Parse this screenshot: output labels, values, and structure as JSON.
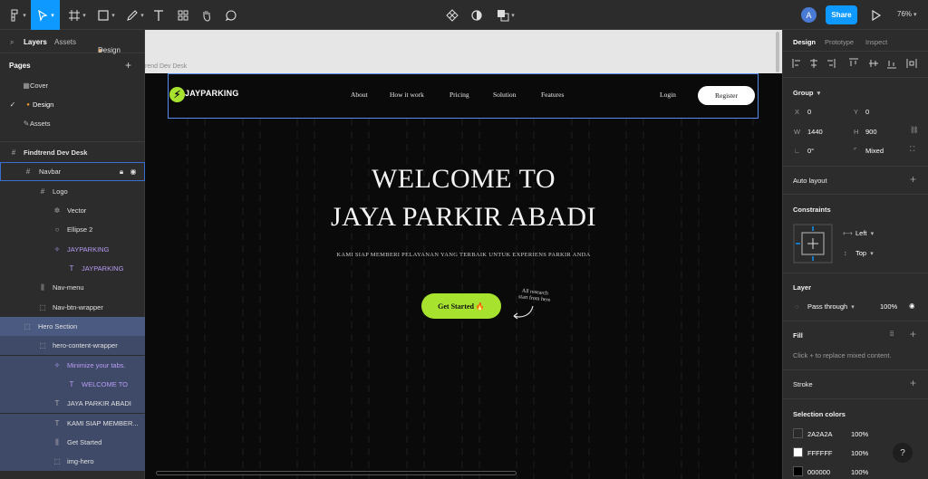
{
  "toolbar": {
    "avatar_initial": "A",
    "share_label": "Share",
    "zoom": "76%"
  },
  "left_panel": {
    "tab_layers": "Layers",
    "tab_assets": "Assets",
    "tab_design": "Design",
    "pages_title": "Pages",
    "pages": [
      "Cover",
      "Design",
      "Assets"
    ],
    "layers": [
      {
        "label": "Findtrend Dev Desk"
      },
      {
        "label": "Navbar"
      },
      {
        "label": "Logo"
      },
      {
        "label": "Vector"
      },
      {
        "label": "Ellipse 2"
      },
      {
        "label": "JAYPARKING"
      },
      {
        "label": "JAYPARKING"
      },
      {
        "label": "Nav-menu"
      },
      {
        "label": "Nav-btn-wrapper"
      },
      {
        "label": "Hero Section"
      },
      {
        "label": "hero-content-wrapper"
      },
      {
        "label": "Minimize your tabs."
      },
      {
        "label": "WELCOME TO"
      },
      {
        "label": "JAYA PARKIR ABADI"
      },
      {
        "label": "KAMI SIAP MEMBER..."
      },
      {
        "label": "Get Started"
      },
      {
        "label": "img-hero"
      }
    ]
  },
  "canvas": {
    "frame_label": "rend Dev Desk",
    "logo_text": "JAYPARKING",
    "nav": [
      "About",
      "How it work",
      "Pricing",
      "Solution",
      "Features"
    ],
    "login": "Login",
    "register": "Register",
    "hero_line1": "WELCOME TO",
    "hero_line2": "JAYA PARKIR ABADI",
    "hero_sub": "KAMI SIAP MEMBERI PELAYANAN YANG TERBAIK UNTUK EXPERIENS PARKIR ANDA",
    "cta": "Get Started",
    "cta_emoji": "🔥",
    "note_line1": "All research",
    "note_line2": "start from here"
  },
  "right_panel": {
    "tabs": [
      "Design",
      "Prototype",
      "Inspect"
    ],
    "group_title": "Group",
    "x_label": "X",
    "x_value": "0",
    "y_label": "Y",
    "y_value": "0",
    "w_label": "W",
    "w_value": "1440",
    "h_label": "H",
    "h_value": "900",
    "rotation": "0°",
    "radius": "Mixed",
    "auto_layout": "Auto layout",
    "constraints_title": "Constraints",
    "constraint_h": "Left",
    "constraint_v": "Top",
    "layer_title": "Layer",
    "blend": "Pass through",
    "opacity": "100%",
    "fill_title": "Fill",
    "fill_note": "Click + to replace mixed content.",
    "stroke_title": "Stroke",
    "selection_colors_title": "Selection colors",
    "selection_colors": [
      {
        "hex": "2A2A2A",
        "opacity": "100%",
        "color": "#2a2a2a"
      },
      {
        "hex": "FFFFFF",
        "opacity": "100%",
        "color": "#ffffff"
      },
      {
        "hex": "000000",
        "opacity": "100%",
        "color": "#000000"
      }
    ]
  },
  "colors": {
    "accent": "#0d99ff",
    "brand_green": "#a6e22e"
  }
}
